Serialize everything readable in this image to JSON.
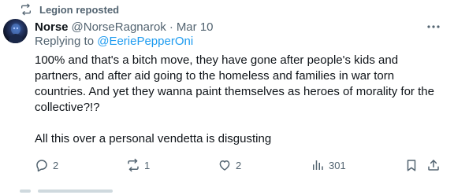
{
  "repost": {
    "label": "Legion reposted",
    "icon": "repost-icon"
  },
  "author": {
    "name": "Norse",
    "handle": "@NorseRagnarok",
    "separator": "·",
    "date": "Mar 10"
  },
  "reply_to": {
    "prefix": "Replying to",
    "handle": "@EeriePepperOni"
  },
  "body": {
    "paragraph1": "100% and that's a bitch move, they have gone after people's kids and partners, and after aid going to the homeless and families in war torn countries. And yet they wanna paint themselves as heroes of morality for the collective?!?",
    "paragraph2": "All this over a personal vendetta is disgusting"
  },
  "actions": {
    "replies": "2",
    "reposts": "1",
    "likes": "2",
    "views": "301"
  },
  "colors": {
    "text": "#0f1419",
    "secondary": "#536471",
    "link": "#1d9bf0"
  }
}
